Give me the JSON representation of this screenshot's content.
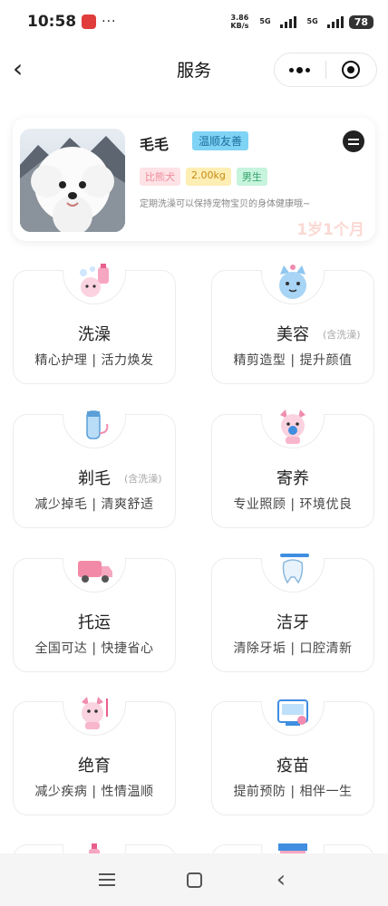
{
  "status": {
    "time": "10:58",
    "speed_top": "3.86",
    "speed_unit": "KB/s",
    "signal1": "5G",
    "signal2": "5G",
    "battery": "78"
  },
  "header": {
    "title": "服务"
  },
  "pet": {
    "name": "毛毛",
    "temperament": "温顺友善",
    "breed": "比熊犬",
    "weight": "2.00kg",
    "gender": "男生",
    "tip": "定期洗澡可以保持宠物宝贝的身体健康哦~",
    "age": "1岁1个月"
  },
  "services": [
    {
      "name": "洗澡",
      "note": "",
      "desc": "精心护理 | 活力焕发",
      "icon": "dog-bath-icon"
    },
    {
      "name": "美容",
      "note": "(含洗澡)",
      "desc": "精剪造型 | 提升颜值",
      "icon": "cat-grooming-icon"
    },
    {
      "name": "剃毛",
      "note": "(含洗澡)",
      "desc": "减少掉毛 | 清爽舒适",
      "icon": "clipper-icon"
    },
    {
      "name": "寄养",
      "note": "",
      "desc": "专业照顾 | 环境优良",
      "icon": "dog-boarding-icon"
    },
    {
      "name": "托运",
      "note": "",
      "desc": "全国可达 | 快捷省心",
      "icon": "truck-icon"
    },
    {
      "name": "洁牙",
      "note": "",
      "desc": "清除牙垢 | 口腔清新",
      "icon": "tooth-brush-icon"
    },
    {
      "name": "绝育",
      "note": "",
      "desc": "减少疾病 | 性情温顺",
      "icon": "dog-neuter-icon"
    },
    {
      "name": "疫苗",
      "note": "",
      "desc": "提前预防 | 相伴一生",
      "icon": "vaccine-icon"
    }
  ]
}
